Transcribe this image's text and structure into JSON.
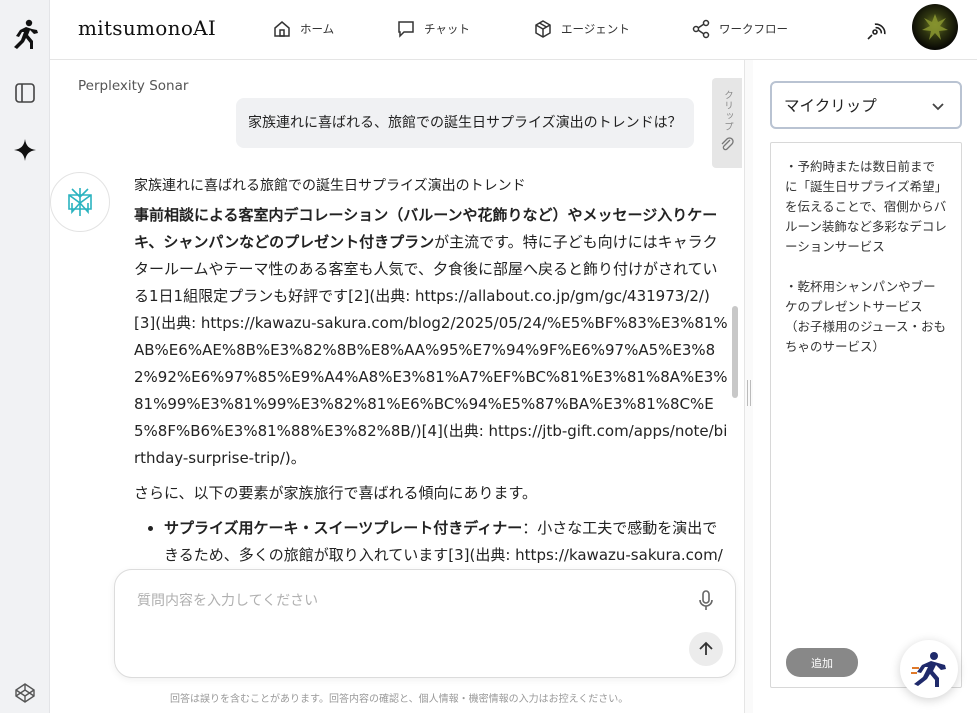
{
  "app": {
    "brand": "mitsumonoAI"
  },
  "nav": [
    {
      "label": "ホーム",
      "icon": "home-icon"
    },
    {
      "label": "チャット",
      "icon": "chat-icon"
    },
    {
      "label": "エージェント",
      "icon": "cube-icon"
    },
    {
      "label": "ワークフロー",
      "icon": "share-nodes-icon"
    }
  ],
  "chat": {
    "model": "Perplexity Sonar",
    "user_message": "家族連れに喜ばれる、旅館での誕生日サプライズ演出のトレンドは？",
    "answer": {
      "heading": "家族連れに喜ばれる旅館での誕生日サプライズ演出のトレンド",
      "para1_bold": "事前相談による客室内デコレーション（バルーンや花飾りなど）やメッセージ入りケーキ、シャンパンなどのプレゼント付きプラン",
      "para1_rest": "が主流です。特に子ども向けにはキャラクタールームやテーマ性のある客室も人気で、夕食後に部屋へ戻ると飾り付けがされている1日1組限定プランも好評です[2](出典: https://allabout.co.jp/gm/gc/431973/2/)[3](出典: https://kawazu-sakura.com/blog2/2025/05/24/%E5%BF%83%E3%81%AB%E6%AE%8B%E3%82%8B%E8%AA%95%E7%94%9F%E6%97%A5%E3%82%92%E6%97%85%E9%A4%A8%E3%81%A7%EF%BC%81%E3%81%8A%E3%81%99%E3%81%99%E3%82%81%E6%BC%94%E5%87%BA%E3%81%8C%E5%8F%B6%E3%81%88%E3%82%8B/)[4](出典: https://jtb-gift.com/apps/note/birthday-surprise-trip/)。",
      "para2": "さらに、以下の要素が家族旅行で喜ばれる傾向にあります。",
      "bullet1_bold": "サプライズ用ケーキ・スイーツプレート付きディナー",
      "bullet1_rest": "：小さな工夫で感動を演出できるため、多くの旅館が取り入れています[3](出典: https://kawazu-sakura.com/"
    },
    "clip_tab_label": "クリップ",
    "input_placeholder": "質問内容を入力してください",
    "disclaimer": "回答は誤りを含むことがあります。回答内容の確認と、個人情報・機密情報の入力はお控えください。"
  },
  "clip_panel": {
    "selected": "マイクリップ",
    "note": "・予約時または数日前までに「誕生日サプライズ希望」を伝えることで、宿側からバルーン装飾など多彩なデコレーションサービス\n\n・乾杯用シャンパンやブーケのプレゼントサービス（お子様用のジュース・おもちゃのサービス）",
    "add_label": "追加"
  },
  "colors": {
    "accent_teal": "#2bb3c0",
    "rail_bg": "#f1f2f4"
  }
}
